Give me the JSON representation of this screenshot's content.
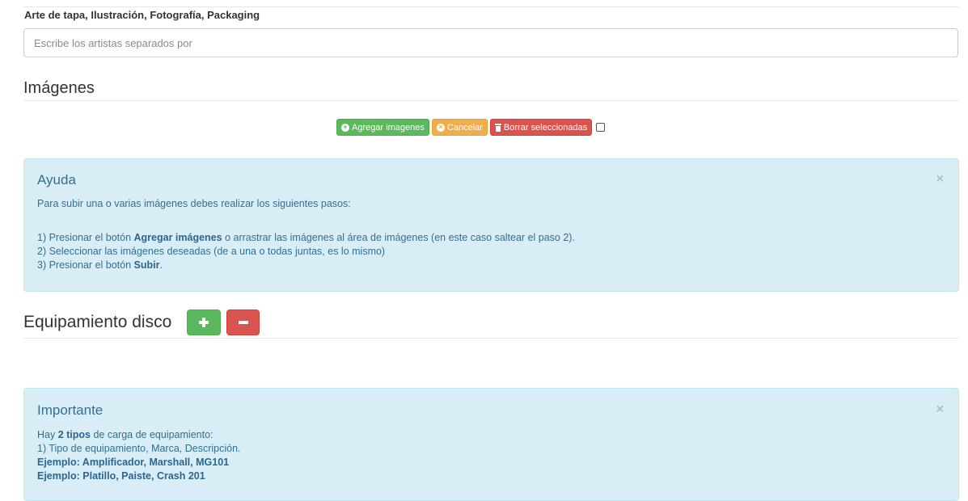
{
  "artists_field": {
    "label": "Arte de tapa, Ilustración, Fotografía, Packaging",
    "placeholder": "Escribe los artistas separados por",
    "value": ""
  },
  "images_section": {
    "title": "Imágenes",
    "toolbar": {
      "add_label": "Agregar imagenes",
      "cancel_label": "Cancelar",
      "delete_label": "Borrar seleccionadas"
    }
  },
  "help_alert": {
    "title": "Ayuda",
    "close": "×",
    "intro": "Para subir una o varias imágenes debes realizar los siguientes pasos:",
    "step1_pre": "1) Presionar el botón ",
    "step1_bold": "Agregar imágenes",
    "step1_post": " o arrastrar las imágenes al área de imágenes (en este caso saltear el paso 2).",
    "step2": "2) Seleccionar las imágenes deseadas (de a una o todas juntas, es lo mismo)",
    "step3_pre": "3) Presionar el botón ",
    "step3_bold": "Subir",
    "step3_post": "."
  },
  "equipment_section": {
    "title": "Equipamiento disco"
  },
  "important_alert": {
    "title": "Importante",
    "close": "×",
    "line1_pre": "Hay ",
    "line1_bold": "2 tipos",
    "line1_post": " de carga de equipamiento:",
    "line2": "1) Tipo de equipamiento, Marca, Descripción.",
    "example1": "Ejemplo: Amplificador, Marshall, MG101",
    "example2": "Ejemplo: Platillo, Paiste, Crash 201"
  },
  "colors": {
    "success": "#5cb85c",
    "warning": "#f0ad4e",
    "danger": "#d9534f",
    "info_bg": "#d9edf7",
    "info_text": "#31708f"
  },
  "icons": {
    "add": "plus-circle-icon",
    "cancel": "times-circle-icon",
    "delete": "trash-icon",
    "equipment_add": "plus-icon",
    "equipment_remove": "minus-icon"
  }
}
